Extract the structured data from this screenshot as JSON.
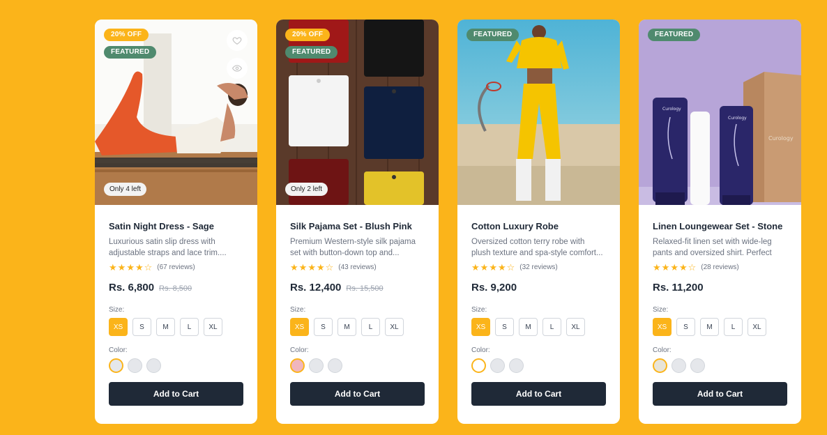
{
  "colors": {
    "accent": "#fbb41a",
    "featured": "#4f8a6e",
    "button": "#1f2937"
  },
  "products": [
    {
      "discount": "20% OFF",
      "featured": "FEATURED",
      "stock": "Only 4 left",
      "title": "Satin Night Dress - Sage",
      "description": "Luxurious satin slip dress with adjustable straps and lace trim....",
      "rating": 4,
      "reviews": "(67 reviews)",
      "price": "Rs. 6,800",
      "old_price": "Rs. 8,500",
      "size_label": "Size:",
      "sizes": [
        "XS",
        "S",
        "M",
        "L",
        "XL"
      ],
      "selected_size": "XS",
      "color_label": "Color:",
      "swatches": [
        "#e5e7eb",
        "#e5e7eb",
        "#e5e7eb"
      ],
      "cart_label": "Add to Cart",
      "icons": [
        "heart-icon",
        "eye-icon"
      ]
    },
    {
      "discount": "20% OFF",
      "featured": "FEATURED",
      "stock": "Only 2 left",
      "title": "Silk Pajama Set - Blush Pink",
      "description": "Premium Western-style silk pajama set with button-down top and...",
      "rating": 4,
      "reviews": "(43 reviews)",
      "price": "Rs. 12,400",
      "old_price": "Rs. 15,500",
      "size_label": "Size:",
      "sizes": [
        "XS",
        "S",
        "M",
        "L",
        "XL"
      ],
      "selected_size": "XS",
      "color_label": "Color:",
      "swatches": [
        "#f0b6bd",
        "#e5e7eb",
        "#e5e7eb"
      ],
      "cart_label": "Add to Cart"
    },
    {
      "featured": "FEATURED",
      "title": "Cotton Luxury Robe",
      "description": "Oversized cotton terry robe with plush texture and spa-style comfort...",
      "rating": 4,
      "reviews": "(32 reviews)",
      "price": "Rs. 9,200",
      "size_label": "Size:",
      "sizes": [
        "XS",
        "S",
        "M",
        "L",
        "XL"
      ],
      "selected_size": "XS",
      "color_label": "Color:",
      "swatches": [
        "#ffffff",
        "#e5e7eb",
        "#e5e7eb"
      ],
      "cart_label": "Add to Cart"
    },
    {
      "featured": "FEATURED",
      "title": "Linen Loungewear Set - Stone",
      "description": "Relaxed-fit linen set with wide-leg pants and oversized shirt. Perfect fo...",
      "rating": 4,
      "reviews": "(28 reviews)",
      "price": "Rs. 11,200",
      "size_label": "Size:",
      "sizes": [
        "XS",
        "S",
        "M",
        "L",
        "XL"
      ],
      "selected_size": "XS",
      "color_label": "Color:",
      "swatches": [
        "#e8e4d8",
        "#e5e7eb",
        "#e5e7eb"
      ],
      "cart_label": "Add to Cart",
      "image_text": {
        "brand": "Curology",
        "tube_text": "Curology"
      }
    }
  ]
}
